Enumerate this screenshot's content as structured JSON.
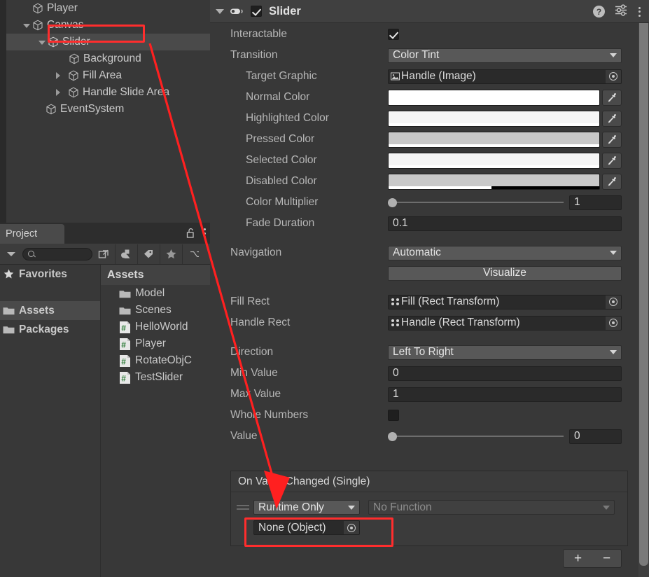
{
  "hierarchy": {
    "name": "hierarchy-panel",
    "rows": [
      {
        "label": "Player",
        "indent": 1,
        "fold": "none",
        "selected": false
      },
      {
        "label": "Canvas",
        "indent": 1,
        "fold": "open",
        "selected": false
      },
      {
        "label": "Slider",
        "indent": 2,
        "fold": "open",
        "selected": true
      },
      {
        "label": "Background",
        "indent": 3,
        "fold": "none",
        "selected": false
      },
      {
        "label": "Fill Area",
        "indent": 3,
        "fold": "closed",
        "selected": false
      },
      {
        "label": "Handle Slide Area",
        "indent": 3,
        "fold": "closed",
        "selected": false
      },
      {
        "label": "EventSystem",
        "indent": 1,
        "fold": "none",
        "selected": false
      }
    ]
  },
  "project": {
    "tab_label": "Project",
    "lock_icon": "lock-open-icon",
    "menu_icon": "kebab-menu-icon",
    "search_placeholder": "",
    "search_value": "",
    "toolbar_icons": [
      "dropdown-arrow-icon",
      "search-icon",
      "open-in-new-icon",
      "asset-type-icon",
      "label-tag-icon",
      "favorite-star-icon",
      "saved-search-icon"
    ],
    "tree": [
      {
        "label": "Favorites",
        "icon": "star-icon",
        "bold": true,
        "selected": false
      },
      {
        "label": "Assets",
        "icon": "folder-icon",
        "bold": true,
        "selected": true
      },
      {
        "label": "Packages",
        "icon": "folder-icon",
        "bold": true,
        "selected": false
      }
    ],
    "content_header": "Assets",
    "assets": [
      {
        "label": "Model",
        "icon": "folder-icon"
      },
      {
        "label": "Scenes",
        "icon": "folder-icon"
      },
      {
        "label": "HelloWorld",
        "icon": "csharp-script-icon"
      },
      {
        "label": "Player",
        "icon": "csharp-script-icon"
      },
      {
        "label": "RotateObjC",
        "icon": "csharp-script-icon"
      },
      {
        "label": "TestSlider",
        "icon": "csharp-script-icon"
      }
    ]
  },
  "inspector": {
    "component_title": "Slider",
    "component_enabled": true,
    "header_icons": [
      "help-icon",
      "preset-icon",
      "kebab-menu-icon"
    ],
    "fields": {
      "interactable": {
        "label": "Interactable",
        "checked": true
      },
      "transition": {
        "label": "Transition",
        "value": "Color Tint"
      },
      "target_graphic": {
        "label": "Target Graphic",
        "value": "Handle (Image)",
        "icon": "image-component-icon"
      },
      "normal_color": {
        "label": "Normal Color",
        "color": "#ffffff",
        "alpha_pct": 100
      },
      "highlighted_color": {
        "label": "Highlighted Color",
        "color": "#f5f5f5",
        "alpha_pct": 100
      },
      "pressed_color": {
        "label": "Pressed Color",
        "color": "#c8c8c8",
        "alpha_pct": 100
      },
      "selected_color": {
        "label": "Selected Color",
        "color": "#f5f5f5",
        "alpha_pct": 100
      },
      "disabled_color": {
        "label": "Disabled Color",
        "color": "#c8c8c8",
        "alpha_pct": 49
      },
      "color_multiplier": {
        "label": "Color Multiplier",
        "value": "1",
        "slider_pct": 0
      },
      "fade_duration": {
        "label": "Fade Duration",
        "value": "0.1"
      },
      "navigation": {
        "label": "Navigation",
        "value": "Automatic"
      },
      "visualize": {
        "label": "Visualize"
      },
      "fill_rect": {
        "label": "Fill Rect",
        "value": "Fill (Rect Transform)",
        "icon": "rect-transform-icon"
      },
      "handle_rect": {
        "label": "Handle Rect",
        "value": "Handle (Rect Transform)",
        "icon": "rect-transform-icon"
      },
      "direction": {
        "label": "Direction",
        "value": "Left To Right"
      },
      "min_value": {
        "label": "Min Value",
        "value": "0"
      },
      "max_value": {
        "label": "Max Value",
        "value": "1"
      },
      "whole_numbers": {
        "label": "Whole Numbers",
        "checked": false
      },
      "value": {
        "label": "Value",
        "value": "0",
        "slider_pct": 0
      }
    },
    "event": {
      "title": "On Value Changed (Single)",
      "call_mode": "Runtime Only",
      "function": "No Function",
      "object": "None (Object)",
      "add_label": "+",
      "remove_label": "−"
    }
  },
  "annotations": {
    "highlight_color": "#ff2d2d",
    "boxes": [
      "slider-hierarchy-item",
      "none-object-field"
    ],
    "arrow": "red-arrow-pointing-to-runtime-only"
  }
}
